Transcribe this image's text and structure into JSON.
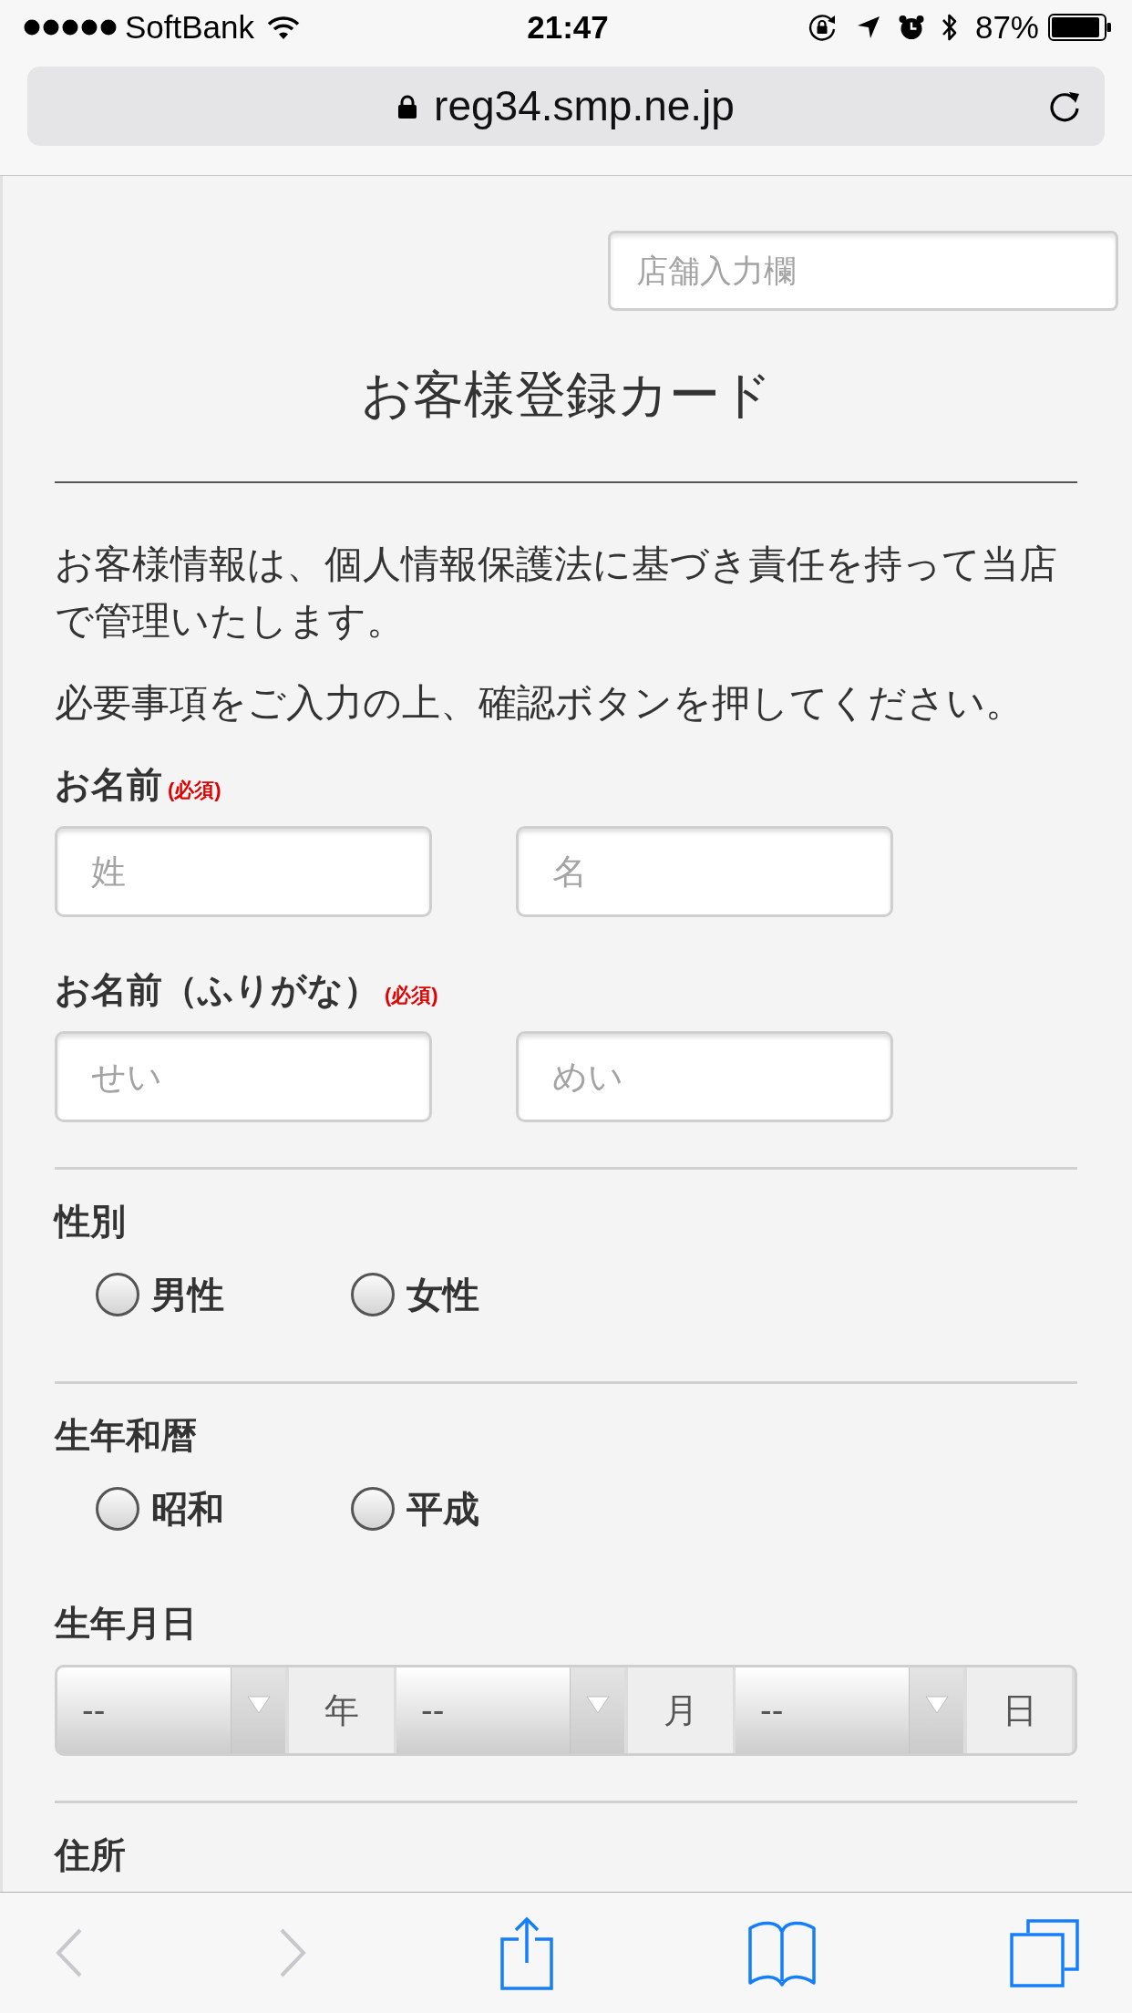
{
  "status_bar": {
    "carrier": "SoftBank",
    "time": "21:47",
    "battery": "87%"
  },
  "address_bar": {
    "url": "reg34.smp.ne.jp"
  },
  "form": {
    "store_field": {
      "placeholder": "店舗入力欄"
    },
    "title": "お客様登録カード",
    "notes": [
      "お客様情報は、個人情報保護法に基づき責任を持って当店で管理いたします。",
      "必要事項をご入力の上、確認ボタンを押してください。"
    ],
    "groups": [
      {
        "sections": [
          {
            "kind": "text_pair",
            "label": "お名前",
            "required": "(必須)",
            "fields": [
              {
                "placeholder": "姓"
              },
              {
                "placeholder": "名"
              }
            ]
          },
          {
            "kind": "text_pair",
            "label": "お名前（ふりがな）",
            "required": "(必須)",
            "fields": [
              {
                "placeholder": "せい"
              },
              {
                "placeholder": "めい"
              }
            ]
          }
        ]
      },
      {
        "sections": [
          {
            "kind": "radio",
            "label": "性別",
            "options": [
              {
                "label": "男性",
                "checked": false
              },
              {
                "label": "女性",
                "checked": false
              }
            ]
          }
        ]
      },
      {
        "sections": [
          {
            "kind": "radio",
            "label": "生年和暦",
            "options": [
              {
                "label": "昭和",
                "checked": false
              },
              {
                "label": "平成",
                "checked": false
              }
            ]
          },
          {
            "kind": "date",
            "label": "生年月日",
            "parts": [
              {
                "value": "--",
                "unit": "年"
              },
              {
                "value": "--",
                "unit": "月"
              },
              {
                "value": "--",
                "unit": "日"
              }
            ]
          }
        ]
      },
      {
        "sections": [
          {
            "kind": "heading",
            "label": "住所"
          }
        ]
      }
    ]
  },
  "toolbar": [
    {
      "kind": "back",
      "disabled": true
    },
    {
      "kind": "forward",
      "disabled": true
    },
    {
      "kind": "share",
      "disabled": false
    },
    {
      "kind": "bookmarks",
      "disabled": false
    },
    {
      "kind": "tabs",
      "disabled": false
    }
  ]
}
